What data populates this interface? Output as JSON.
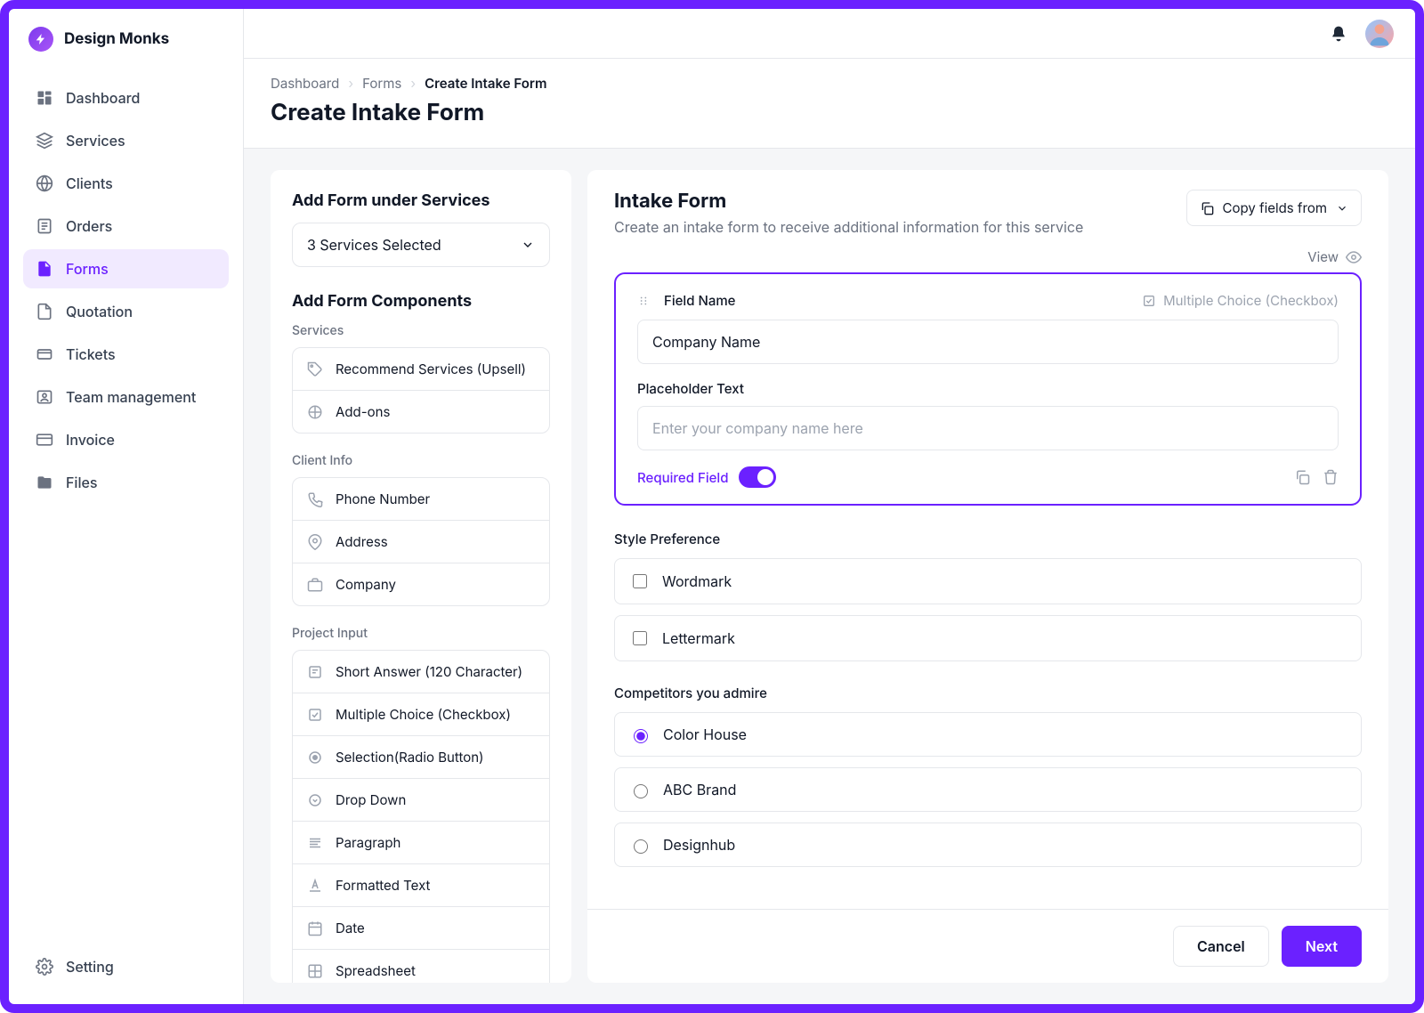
{
  "brand": {
    "name": "Design Monks"
  },
  "sidebar": {
    "items": [
      {
        "id": "dashboard",
        "label": "Dashboard",
        "active": false
      },
      {
        "id": "services",
        "label": "Services",
        "active": false
      },
      {
        "id": "clients",
        "label": "Clients",
        "active": false
      },
      {
        "id": "orders",
        "label": "Orders",
        "active": false
      },
      {
        "id": "forms",
        "label": "Forms",
        "active": true
      },
      {
        "id": "quotation",
        "label": "Quotation",
        "active": false
      },
      {
        "id": "tickets",
        "label": "Tickets",
        "active": false
      },
      {
        "id": "team",
        "label": "Team management",
        "active": false
      },
      {
        "id": "invoice",
        "label": "Invoice",
        "active": false
      },
      {
        "id": "files",
        "label": "Files",
        "active": false
      }
    ],
    "footer": {
      "id": "setting",
      "label": "Setting"
    }
  },
  "breadcrumb": {
    "items": [
      "Dashboard",
      "Forms",
      "Create Intake Form"
    ]
  },
  "page": {
    "title": "Create Intake Form"
  },
  "left_panel": {
    "add_under_services_heading": "Add Form under Services",
    "services_select_label": "3 Services Selected",
    "add_components_heading": "Add Form Components",
    "groups": [
      {
        "label": "Services",
        "items": [
          {
            "id": "recommend",
            "label": "Recommend Services (Upsell)"
          },
          {
            "id": "addons",
            "label": "Add-ons"
          }
        ]
      },
      {
        "label": "Client Info",
        "items": [
          {
            "id": "phone",
            "label": "Phone Number"
          },
          {
            "id": "address",
            "label": "Address"
          },
          {
            "id": "company",
            "label": "Company"
          }
        ]
      },
      {
        "label": "Project Input",
        "items": [
          {
            "id": "short",
            "label": "Short Answer (120 Character)"
          },
          {
            "id": "multi",
            "label": "Multiple Choice (Checkbox)"
          },
          {
            "id": "radio",
            "label": "Selection(Radio Button)"
          },
          {
            "id": "dropdown",
            "label": "Drop Down"
          },
          {
            "id": "paragraph",
            "label": "Paragraph"
          },
          {
            "id": "formatted",
            "label": "Formatted Text"
          },
          {
            "id": "date",
            "label": "Date"
          },
          {
            "id": "spreadsheet",
            "label": "Spreadsheet"
          }
        ]
      }
    ]
  },
  "form": {
    "title": "Intake Form",
    "subtitle": "Create an intake form to receive additional information for this service",
    "copy_button": "Copy fields from",
    "view_label": "View",
    "editor": {
      "field_name_label": "Field Name",
      "type_label": "Multiple Choice (Checkbox)",
      "field_name_value": "Company Name",
      "placeholder_label": "Placeholder Text",
      "placeholder_value": "Enter your company name here",
      "required_label": "Required Field",
      "required_on": true
    },
    "questions": [
      {
        "label": "Style Preference",
        "type": "checkbox",
        "options": [
          {
            "label": "Wordmark",
            "checked": false
          },
          {
            "label": "Lettermark",
            "checked": false
          }
        ]
      },
      {
        "label": "Competitors you admire",
        "type": "radio",
        "options": [
          {
            "label": "Color House",
            "checked": true
          },
          {
            "label": "ABC Brand",
            "checked": false
          },
          {
            "label": "Designhub",
            "checked": false
          }
        ]
      }
    ],
    "footer": {
      "cancel": "Cancel",
      "next": "Next"
    }
  }
}
